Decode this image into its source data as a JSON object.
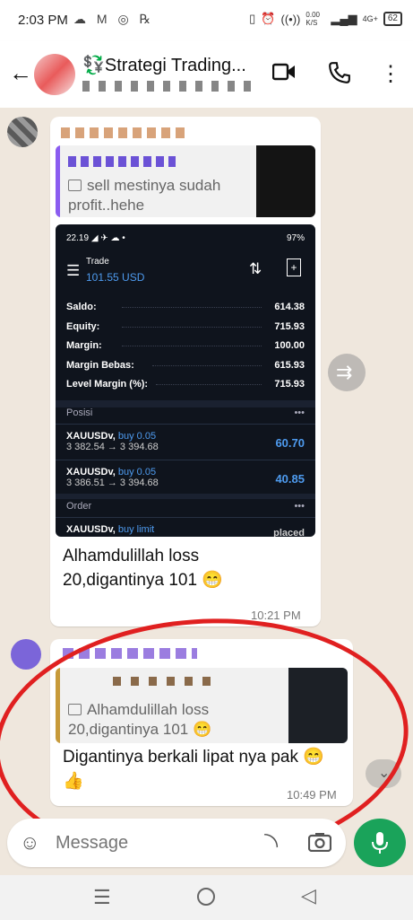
{
  "status_bar": {
    "time": "2:03 PM",
    "left_icons": "☁ M ◎ ℞",
    "net_speed": "0.00 K/S",
    "signal": "4G+",
    "battery": "62"
  },
  "header": {
    "chat_title": "💱Strategi Trading...",
    "icons": [
      "back-arrow-icon",
      "video-call-icon",
      "voice-call-icon",
      "more-options-icon"
    ]
  },
  "message1": {
    "quoted_text": "sell mestinya sudah profit..hehe",
    "image": {
      "status_time": "22.19",
      "status_battery": "97%",
      "screen_title": "Trade",
      "balance_line": "101.55 USD",
      "rows": [
        {
          "label": "Saldo:",
          "value": "614.38"
        },
        {
          "label": "Equity:",
          "value": "715.93"
        },
        {
          "label": "Margin:",
          "value": "100.00"
        },
        {
          "label": "Margin Bebas:",
          "value": "615.93"
        },
        {
          "label": "Level Margin (%):",
          "value": "715.93"
        }
      ],
      "positions_header": "Posisi",
      "positions": [
        {
          "symbol": "XAUUSDv,",
          "side": "buy 0.05",
          "prices": "3 382.54 → 3 394.68",
          "profit": "60.70"
        },
        {
          "symbol": "XAUUSDv,",
          "side": "buy 0.05",
          "prices": "3 386.51 → 3 394.68",
          "profit": "40.85"
        }
      ],
      "orders_header": "Order",
      "order": {
        "symbol": "XAUUSDv,",
        "side": "buy limit",
        "status": "placed"
      }
    },
    "text": "Alhamdulillah loss 20,digantinya 101 😁",
    "time": "10:21 PM"
  },
  "message2": {
    "quoted_text": "Alhamdulillah loss 20,digantinya 101 😁",
    "text": "Digantinya berkali lipat nya pak 😁👍",
    "time": "10:49 PM"
  },
  "composer": {
    "placeholder": "Message"
  },
  "colors": {
    "accent_green": "#1aa35a",
    "annotation_red": "#e02020",
    "trade_bg": "#0f141d",
    "profit_blue": "#4e9bef"
  }
}
